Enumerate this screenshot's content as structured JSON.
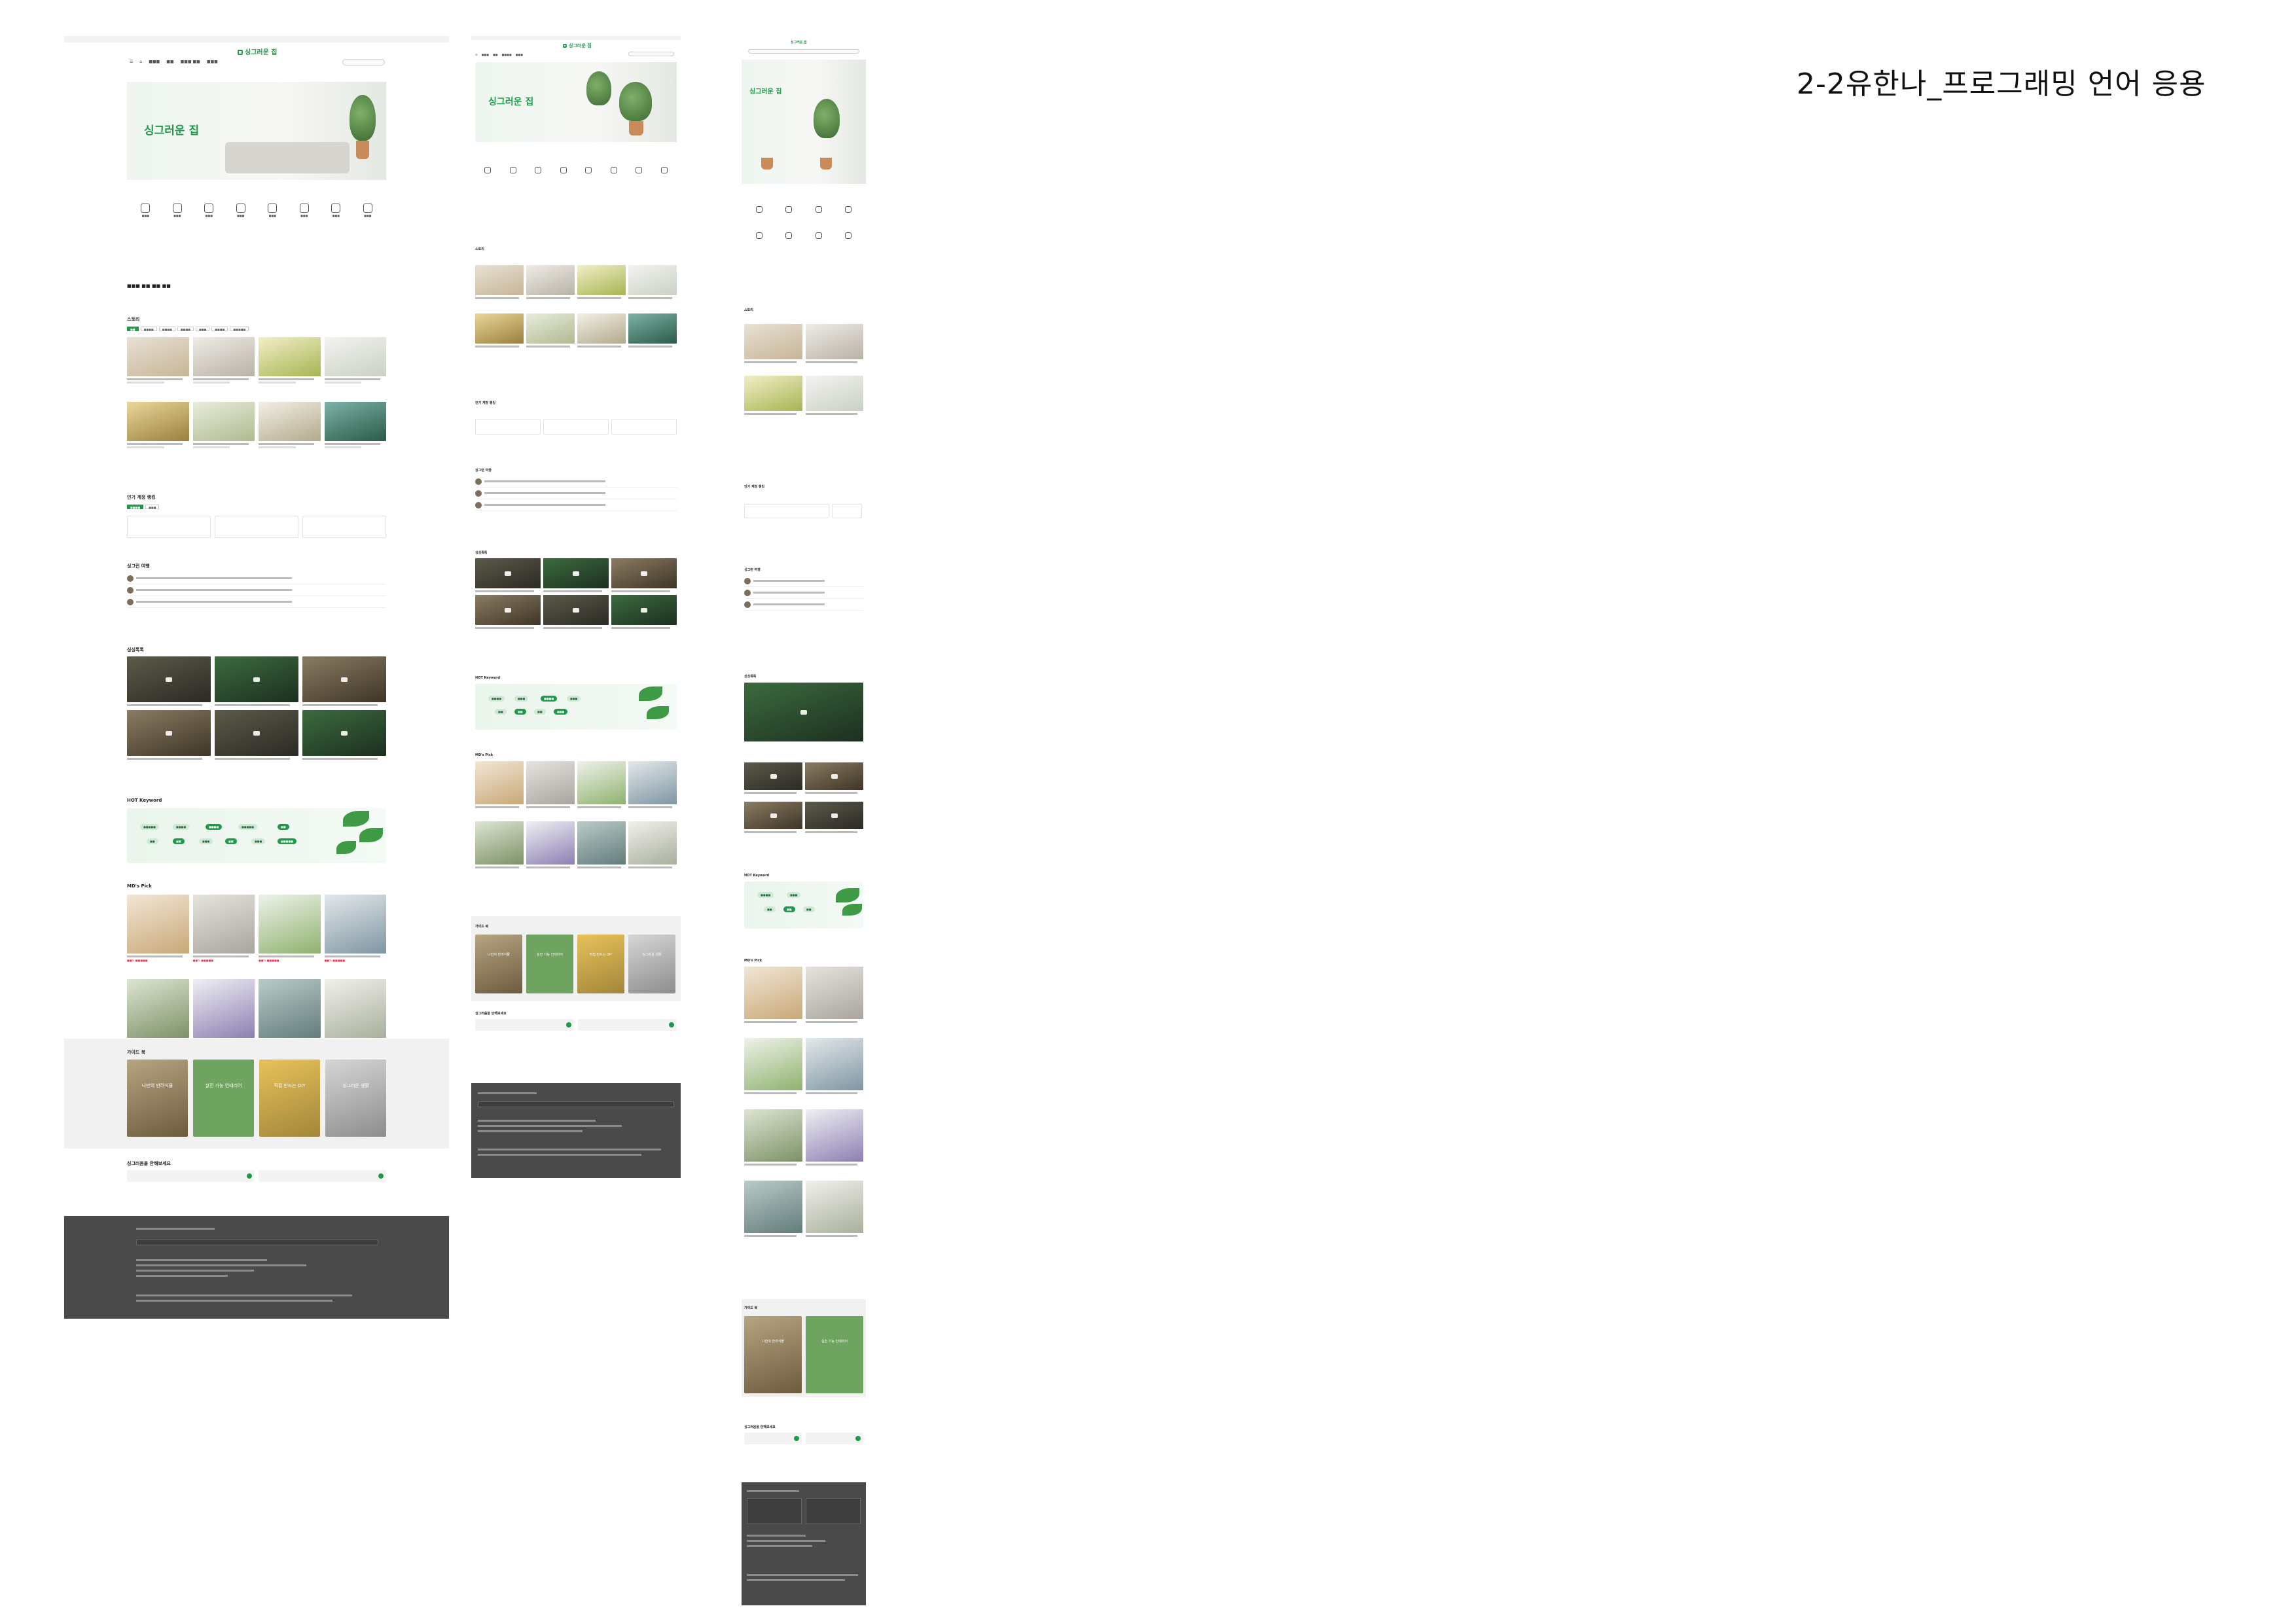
{
  "document": {
    "title": "2-2유한나_프로그래밍 언어 응용"
  },
  "site": {
    "logo": "싱그러운 집"
  },
  "sections": {
    "story": "스토리",
    "ranking": "인기 계정 랭킹",
    "diary": "싱그런 여행",
    "video": "싱싱톡톡",
    "hot": "HOT Keyword",
    "md": "MD's Pick",
    "guide": "가이드 북",
    "ask": "싱그러움을 안해보세요"
  },
  "guide_cards": [
    "나만의 반려식물",
    "실전 가능 인테리어",
    "직접 만드는 DIY",
    "싱그러운 생활"
  ],
  "colors": {
    "brand_green": "#1f9a4a",
    "footer_bg": "#4a4a4a"
  }
}
